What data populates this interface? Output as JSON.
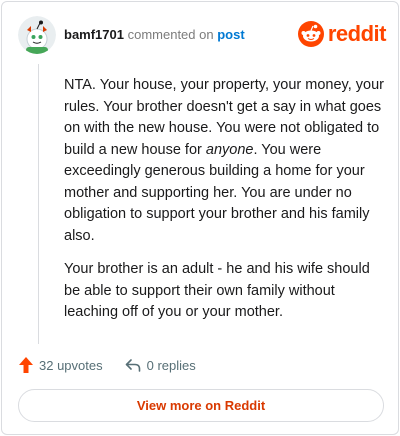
{
  "colors": {
    "brand": "#ff4500",
    "link": "#0079d3",
    "upvote": "#ff4500"
  },
  "comment": {
    "username": "bamf1701",
    "action": " commented on ",
    "post_label": "post",
    "paragraphs": {
      "p1_before": "NTA. Your house, your property, your money, your rules. Your brother doesn't get a say in what goes on with the new house. You were not obligated to build a new house for ",
      "p1_emph": "anyone",
      "p1_after": ". You were exceedingly generous building a home for your mother and supporting her. You are under no obligation to support your brother and his family also.",
      "p2": "Your brother is an adult - he and his wife should be able to support their own family without leaching off of you or your mother."
    }
  },
  "brand": {
    "name": "reddit",
    "icon": "reddit-snoo-icon"
  },
  "stats": {
    "upvotes": "32 upvotes",
    "replies": "0 replies"
  },
  "footer": {
    "view_more": "View more on Reddit"
  },
  "icons": {
    "upvote": "upvote-arrow-icon",
    "reply": "reply-arrow-icon",
    "avatar": "snoo-avatar-icon"
  }
}
